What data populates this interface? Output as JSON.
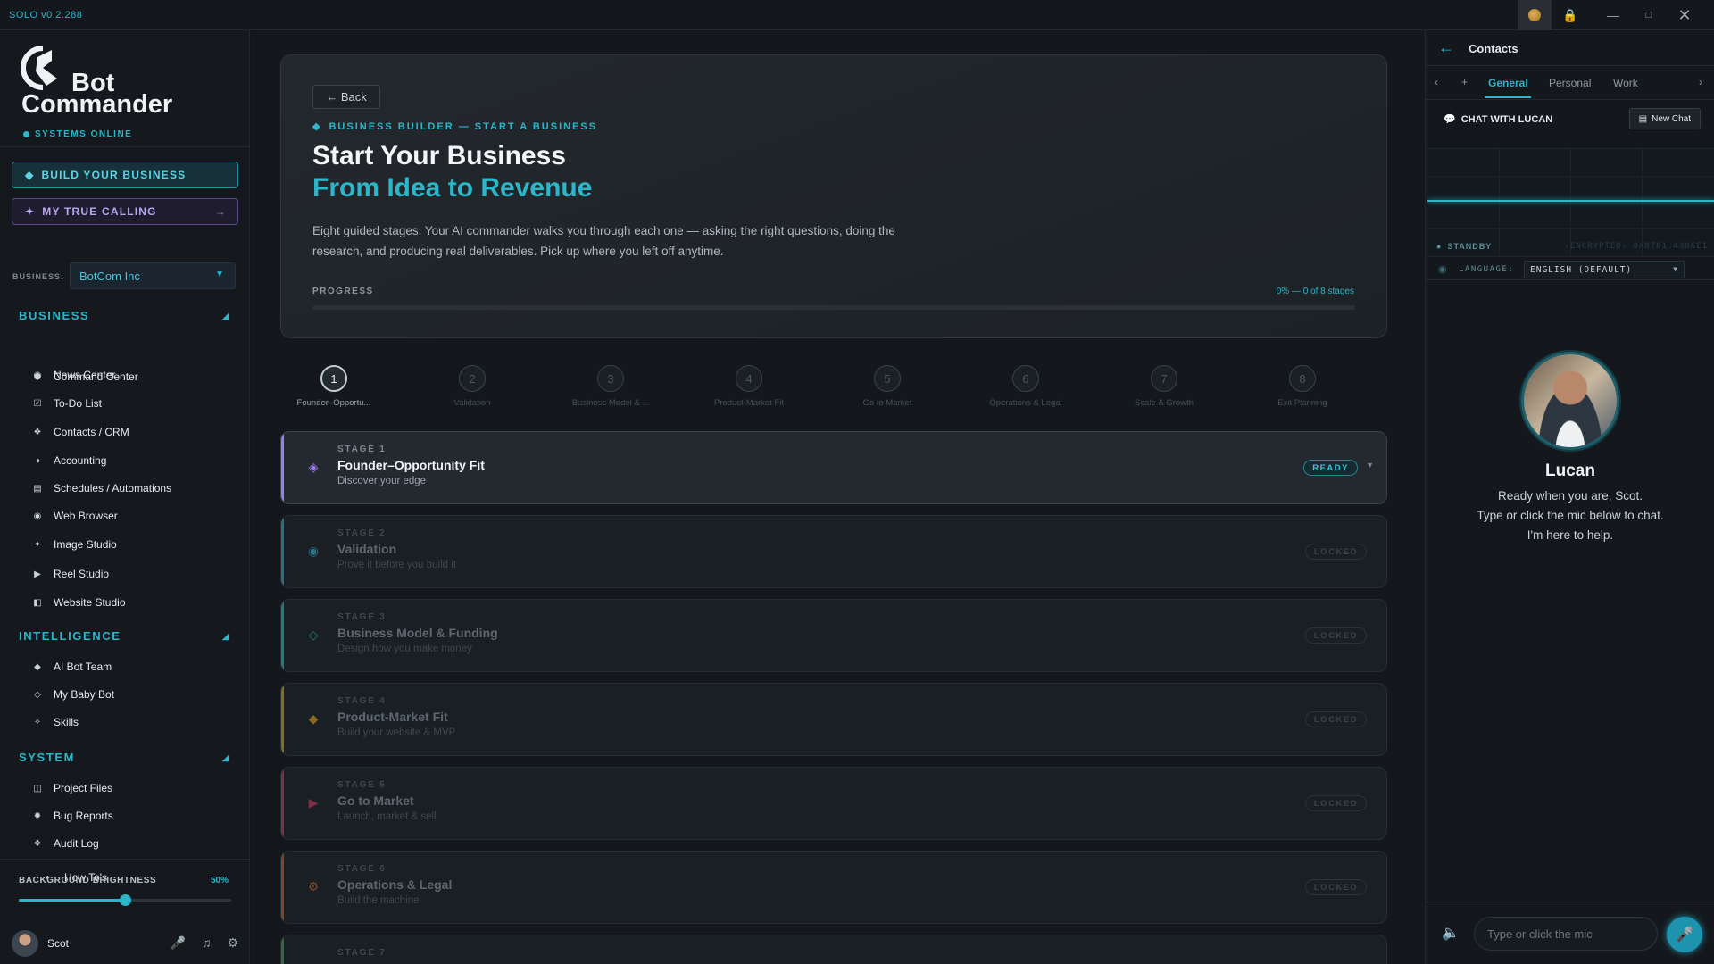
{
  "window": {
    "title": "SOLO v0.2.288",
    "icons": [
      "coin-icon",
      "lock-icon",
      "minimize-icon",
      "maximize-icon",
      "close-icon"
    ]
  },
  "sidebar": {
    "logo_line1": "Bot",
    "logo_line2": "Commander",
    "status": "SYSTEMS ONLINE",
    "build_btn": "BUILD YOUR BUSINESS",
    "calling_btn": "MY TRUE CALLING",
    "calling_arrow": "→",
    "business_label": "BUSINESS:",
    "business_value": "BotCom Inc",
    "sections": {
      "business": "BUSINESS",
      "intelligence": "INTELLIGENCE",
      "system": "SYSTEM"
    },
    "items": {
      "command_center": "Command Center",
      "news_center": "News Center",
      "todo": "To-Do List",
      "contacts": "Contacts / CRM",
      "accounting": "Accounting",
      "schedules": "Schedules / Automations",
      "web_browser": "Web Browser",
      "image_studio": "Image Studio",
      "reel_studio": "Reel Studio",
      "website_studio": "Website Studio",
      "ai_bot_team": "AI Bot Team",
      "my_baby_bot": "My Baby Bot",
      "skills": "Skills",
      "project_files": "Project Files",
      "bug_reports": "Bug Reports",
      "audit_log": "Audit Log",
      "how_tos": "How To's"
    },
    "brightness_label": "BACKGROUND BRIGHTNESS",
    "brightness_value": "50%",
    "brightness_level": 0.5,
    "user_name": "Scot"
  },
  "main": {
    "back": "← Back",
    "eyebrow": "BUSINESS BUILDER — START A BUSINESS",
    "title": "Start Your Business",
    "subtitle": "From Idea to Revenue",
    "description": "Eight guided stages. Your AI commander walks you through each one — asking the right questions, doing the research, and producing real deliverables. Pick up where you left off anytime.",
    "progress_label": "PROGRESS",
    "progress_status": "0% — 0 of 8 stages",
    "progress_fraction": 0,
    "steps": [
      {
        "num": "1",
        "label": "Founder–Opportu..."
      },
      {
        "num": "2",
        "label": "Validation"
      },
      {
        "num": "3",
        "label": "Business Model & ..."
      },
      {
        "num": "4",
        "label": "Product-Market Fit"
      },
      {
        "num": "5",
        "label": "Go to Market"
      },
      {
        "num": "6",
        "label": "Operations & Legal"
      },
      {
        "num": "7",
        "label": "Scale & Growth"
      },
      {
        "num": "8",
        "label": "Exit Planning"
      }
    ],
    "stages": [
      {
        "num": "STAGE 1",
        "title": "Founder–Opportunity Fit",
        "sub": "Discover your edge",
        "badge": "READY",
        "color": "#9b7bf0",
        "icon": "◈"
      },
      {
        "num": "STAGE 2",
        "title": "Validation",
        "sub": "Prove it before you build it",
        "badge": "LOCKED",
        "color": "#2a6f86",
        "icon": "◉"
      },
      {
        "num": "STAGE 3",
        "title": "Business Model & Funding",
        "sub": "Design how you make money",
        "badge": "LOCKED",
        "color": "#1f7d80",
        "icon": "◇"
      },
      {
        "num": "STAGE 4",
        "title": "Product-Market Fit",
        "sub": "Build your website & MVP",
        "badge": "LOCKED",
        "color": "#8a6a24",
        "icon": "◆"
      },
      {
        "num": "STAGE 5",
        "title": "Go to Market",
        "sub": "Launch, market & sell",
        "badge": "LOCKED",
        "color": "#7d2f45",
        "icon": "▶"
      },
      {
        "num": "STAGE 6",
        "title": "Operations & Legal",
        "sub": "Build the machine",
        "badge": "LOCKED",
        "color": "#7a4a26",
        "icon": "⚙"
      },
      {
        "num": "STAGE 7",
        "title": "",
        "sub": "",
        "badge": "",
        "color": "#2f6b3c",
        "icon": ""
      }
    ]
  },
  "right_panel": {
    "title": "Contacts",
    "tabs": {
      "general": "General",
      "personal": "Personal",
      "work": "Work"
    },
    "chat_label": "CHAT WITH LUCAN",
    "new_chat": "New Chat",
    "standby": "STANDBY",
    "encrypted": "‹ENCRYPTED› 0X8701.4386E1",
    "language_label": "LANGUAGE:",
    "language_value": "ENGLISH (DEFAULT)",
    "persona_name": "Lucan",
    "persona_line1": "Ready when you are, Scot.",
    "persona_line2": "Type or click the mic below to chat.",
    "persona_line3": "I'm here to help.",
    "input_placeholder": "Type or click the mic"
  }
}
